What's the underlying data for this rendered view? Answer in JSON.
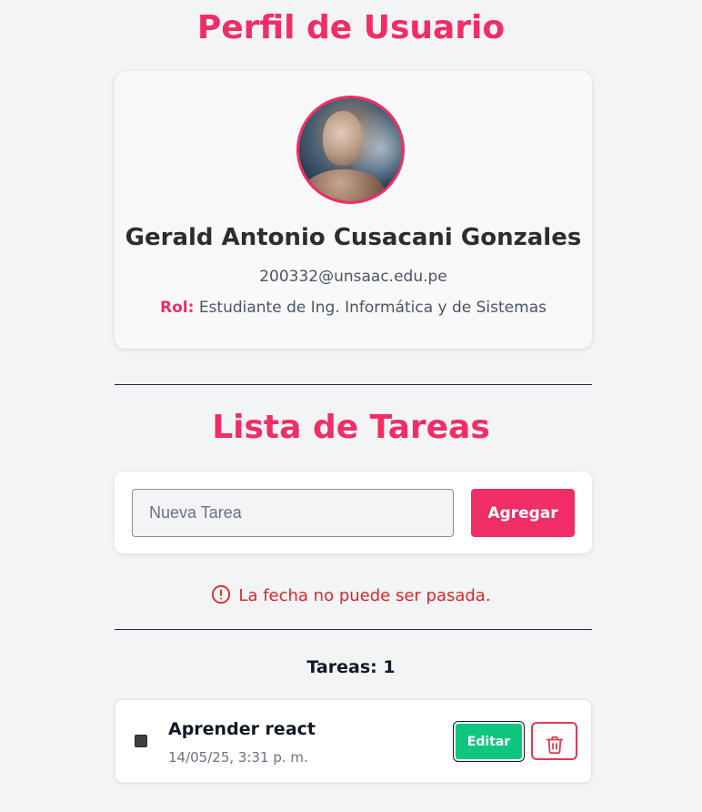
{
  "profile": {
    "heading": "Perfil de Usuario",
    "name": "Gerald Antonio Cusacani Gonzales",
    "email": "200332@unsaac.edu.pe",
    "role_label": "Rol:",
    "role_value": "Estudiante de Ing. Informática y de Sistemas",
    "avatar_icon": "user-photo-icon"
  },
  "tasks": {
    "heading": "Lista de Tareas",
    "input_placeholder": "Nueva Tarea",
    "input_value": "",
    "add_label": "Agregar",
    "error_message": "La fecha no puede ser pasada.",
    "error_icon": "alert-circle-icon",
    "count_text": "Tareas: 1",
    "items": [
      {
        "title": "Aprender react",
        "date": "14/05/25, 3:31 p. m.",
        "completed": false,
        "edit_label": "Editar",
        "delete_icon": "trash-icon"
      }
    ]
  },
  "colors": {
    "accent": "#f02e65",
    "success": "#10c67f",
    "error": "#dc2626",
    "background": "#f3f4f6"
  }
}
